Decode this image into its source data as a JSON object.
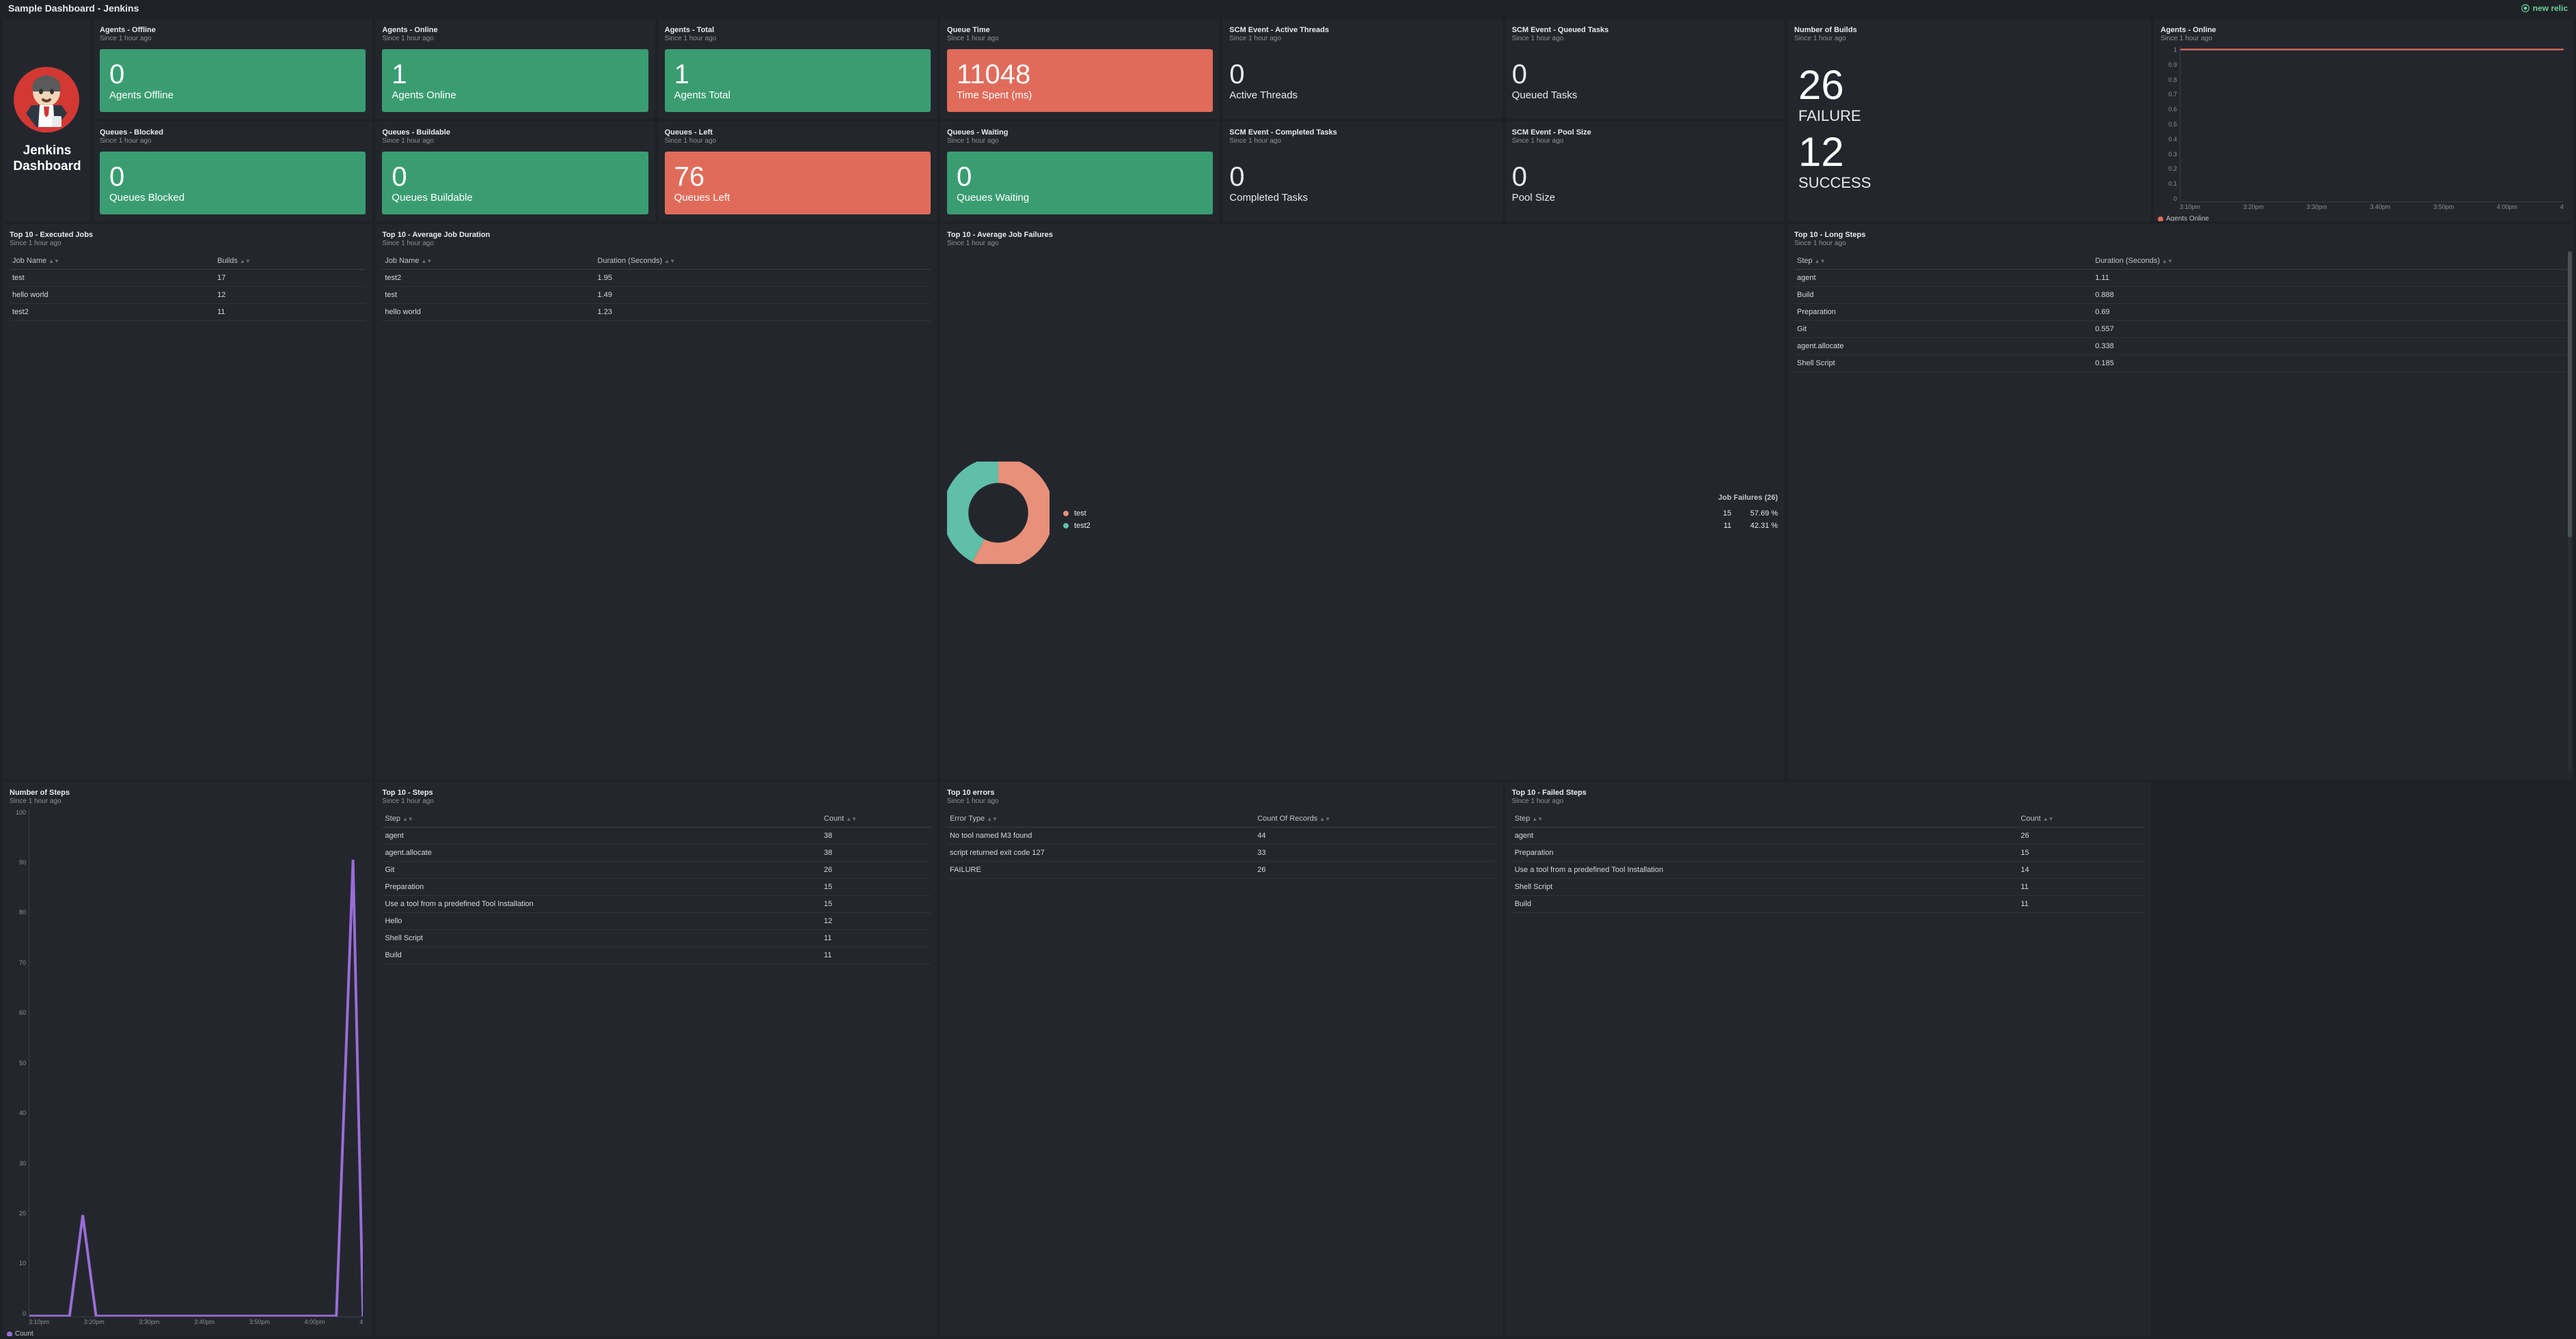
{
  "header": {
    "title": "Sample Dashboard - Jenkins",
    "brand": "new relic"
  },
  "logo": {
    "title": "Jenkins Dashboard"
  },
  "kpiRow1": [
    {
      "title": "Agents - Offline",
      "sub": "Since 1 hour ago",
      "val": "0",
      "label": "Agents Offline",
      "cls": "kpi-green"
    },
    {
      "title": "Agents - Online",
      "sub": "Since 1 hour ago",
      "val": "1",
      "label": "Agents Online",
      "cls": "kpi-green"
    },
    {
      "title": "Agents - Total",
      "sub": "Since 1 hour ago",
      "val": "1",
      "label": "Agents Total",
      "cls": "kpi-green"
    },
    {
      "title": "Queue Time",
      "sub": "Since 1 hour ago",
      "val": "11048",
      "label": "Time Spent (ms)",
      "cls": "kpi-red"
    }
  ],
  "kpiRow2": [
    {
      "title": "Queues - Blocked",
      "sub": "Since 1 hour ago",
      "val": "0",
      "label": "Queues Blocked",
      "cls": "kpi-green"
    },
    {
      "title": "Queues - Buildable",
      "sub": "Since 1 hour ago",
      "val": "0",
      "label": "Queues Buildable",
      "cls": "kpi-green"
    },
    {
      "title": "Queues - Left",
      "sub": "Since 1 hour ago",
      "val": "76",
      "label": "Queues Left",
      "cls": "kpi-red"
    },
    {
      "title": "Queues - Waiting",
      "sub": "Since 1 hour ago",
      "val": "0",
      "label": "Queues Waiting",
      "cls": "kpi-green"
    }
  ],
  "scm": [
    {
      "title": "SCM Event - Active Threads",
      "sub": "Since 1 hour ago",
      "val": "0",
      "label": "Active Threads"
    },
    {
      "title": "SCM Event - Queued Tasks",
      "sub": "Since 1 hour ago",
      "val": "0",
      "label": "Queued Tasks"
    },
    {
      "title": "SCM Event - Completed Tasks",
      "sub": "Since 1 hour ago",
      "val": "0",
      "label": "Completed Tasks"
    },
    {
      "title": "SCM Event - Pool Size",
      "sub": "Since 1 hour ago",
      "val": "0",
      "label": "Pool Size"
    }
  ],
  "builds": {
    "title": "Number of Builds",
    "sub": "Since 1 hour ago",
    "failVal": "26",
    "failLabel": "FAILURE",
    "succVal": "12",
    "succLabel": "SUCCESS"
  },
  "agentsChart": {
    "title": "Agents - Online",
    "sub": "Since 1 hour ago",
    "yticks": [
      "1",
      "0.9",
      "0.8",
      "0.7",
      "0.6",
      "0.5",
      "0.4",
      "0.3",
      "0.2",
      "0.1",
      "0"
    ],
    "xticks": [
      "3:10pm",
      "3:20pm",
      "3:30pm",
      "3:40pm",
      "3:50pm",
      "4:00pm",
      "4"
    ],
    "legend": "Agents Online",
    "color": "#e16b5a"
  },
  "panels": {
    "executed": {
      "title": "Top 10 - Executed Jobs",
      "sub": "Since 1 hour ago",
      "cols": [
        "Job Name",
        "Builds"
      ],
      "rows": [
        [
          "test",
          "17"
        ],
        [
          "hello world",
          "12"
        ],
        [
          "test2",
          "11"
        ]
      ]
    },
    "avgDur": {
      "title": "Top 10 - Average Job Duration",
      "sub": "Since 1 hour ago",
      "cols": [
        "Job Name",
        "Duration (Seconds)"
      ],
      "rows": [
        [
          "test2",
          "1.95"
        ],
        [
          "test",
          "1.49"
        ],
        [
          "hello world",
          "1.23"
        ]
      ]
    },
    "failures": {
      "title": "Top 10 - Average Job Failures",
      "sub": "Since 1 hour ago",
      "legendTitle": "Job Failures (26)",
      "items": [
        {
          "name": "test",
          "count": "15",
          "pct": "57.69 %",
          "color": "#e89079"
        },
        {
          "name": "test2",
          "count": "11",
          "pct": "42.31 %",
          "color": "#5fbfa9"
        }
      ]
    },
    "longSteps": {
      "title": "Top 10 - Long Steps",
      "sub": "Since 1 hour ago",
      "cols": [
        "Step",
        "Duration (Seconds)"
      ],
      "rows": [
        [
          "agent",
          "1.11"
        ],
        [
          "Build",
          "0.888"
        ],
        [
          "Preparation",
          "0.69"
        ],
        [
          "Git",
          "0.557"
        ],
        [
          "agent.allocate",
          "0.338"
        ],
        [
          "Shell Script",
          "0.185"
        ]
      ]
    },
    "numSteps": {
      "title": "Number of Steps",
      "sub": "Since 1 hour ago",
      "yticks": [
        "100",
        "90",
        "80",
        "70",
        "60",
        "50",
        "40",
        "30",
        "20",
        "10",
        "0"
      ],
      "xticks": [
        "3:10pm",
        "3:20pm",
        "3:30pm",
        "3:40pm",
        "3:50pm",
        "4:00pm",
        "4"
      ],
      "legend": "Count",
      "color": "#9a6dd7"
    },
    "topSteps": {
      "title": "Top 10 - Steps",
      "sub": "Since 1 hour ago",
      "cols": [
        "Step",
        "Count"
      ],
      "rows": [
        [
          "agent",
          "38"
        ],
        [
          "agent.allocate",
          "38"
        ],
        [
          "Git",
          "26"
        ],
        [
          "Preparation",
          "15"
        ],
        [
          "Use a tool from a predefined Tool Installation",
          "15"
        ],
        [
          "Hello",
          "12"
        ],
        [
          "Shell Script",
          "11"
        ],
        [
          "Build",
          "11"
        ]
      ]
    },
    "errors": {
      "title": "Top 10 errors",
      "sub": "Since 1 hour ago",
      "cols": [
        "Error Type",
        "Count Of Records"
      ],
      "rows": [
        [
          "No tool named M3 found",
          "44"
        ],
        [
          "script returned exit code 127",
          "33"
        ],
        [
          "FAILURE",
          "26"
        ]
      ]
    },
    "failedSteps": {
      "title": "Top 10 - Failed Steps",
      "sub": "Since 1 hour ago",
      "cols": [
        "Step",
        "Count"
      ],
      "rows": [
        [
          "agent",
          "26"
        ],
        [
          "Preparation",
          "15"
        ],
        [
          "Use a tool from a predefined Tool Installation",
          "14"
        ],
        [
          "Shell Script",
          "11"
        ],
        [
          "Build",
          "11"
        ]
      ]
    }
  },
  "chart_data": [
    {
      "type": "line",
      "title": "Agents - Online",
      "series": [
        {
          "name": "Agents Online",
          "values": [
            1,
            1,
            1,
            1,
            1,
            1,
            1
          ]
        }
      ],
      "x": [
        "3:10pm",
        "3:20pm",
        "3:30pm",
        "3:40pm",
        "3:50pm",
        "4:00pm",
        "4"
      ],
      "ylim": [
        0,
        1
      ]
    },
    {
      "type": "pie",
      "title": "Job Failures (26)",
      "series": [
        {
          "name": "test",
          "value": 15,
          "pct": 57.69
        },
        {
          "name": "test2",
          "value": 11,
          "pct": 42.31
        }
      ]
    },
    {
      "type": "line",
      "title": "Number of Steps",
      "series": [
        {
          "name": "Count",
          "values": [
            0,
            0,
            0,
            0,
            0,
            0,
            20,
            0,
            0,
            0,
            0,
            0,
            90
          ]
        }
      ],
      "x": [
        "3:10pm",
        "3:20pm",
        "3:30pm",
        "3:40pm",
        "3:50pm",
        "4:00pm",
        "4"
      ],
      "ylim": [
        0,
        100
      ]
    }
  ]
}
